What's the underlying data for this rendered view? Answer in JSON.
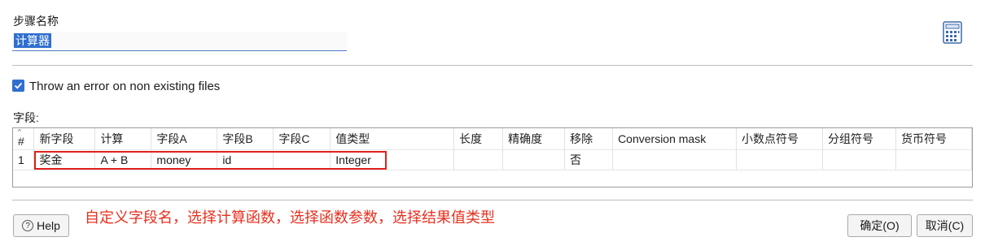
{
  "step": {
    "label": "步骤名称",
    "value": "计算器"
  },
  "checkbox": {
    "checked": true,
    "label": "Throw an error on non existing files"
  },
  "fields_label": "字段:",
  "table": {
    "columns": [
      {
        "label": "#"
      },
      {
        "label": "新字段"
      },
      {
        "label": "计算"
      },
      {
        "label": "字段A"
      },
      {
        "label": "字段B"
      },
      {
        "label": "字段C"
      },
      {
        "label": "值类型"
      },
      {
        "label": "长度"
      },
      {
        "label": "精确度"
      },
      {
        "label": "移除"
      },
      {
        "label": "Conversion mask"
      },
      {
        "label": "小数点符号"
      },
      {
        "label": "分组符号"
      },
      {
        "label": "货币符号"
      }
    ],
    "rows": [
      [
        "1",
        "奖金",
        "A + B",
        "money",
        "id",
        "",
        "Integer",
        "",
        "",
        "否",
        "",
        "",
        "",
        ""
      ]
    ]
  },
  "annotation": "自定义字段名，选择计算函数，选择函数参数，选择结果值类型",
  "buttons": {
    "help": "Help",
    "ok": "确定(O)",
    "cancel": "取消(C)"
  },
  "icons": {
    "calculator": "calculator-icon",
    "check": "check-icon",
    "help": "question-icon"
  },
  "colors": {
    "accent": "#2f6fcf",
    "annotation": "#e8301f"
  }
}
